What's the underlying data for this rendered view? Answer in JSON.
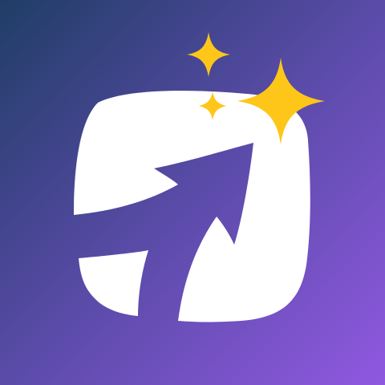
{
  "icon": {
    "gradient_start": "#203d66",
    "gradient_mid": "#5a4ba8",
    "gradient_end": "#9058e0",
    "shape_color": "#ffffff",
    "sparkle_color": "#ffc61a",
    "glyph_name": "arrow-in-rounded-square-icon",
    "sparkle_icons": [
      "large-sparkle-icon",
      "medium-sparkle-icon",
      "small-sparkle-icon"
    ]
  }
}
